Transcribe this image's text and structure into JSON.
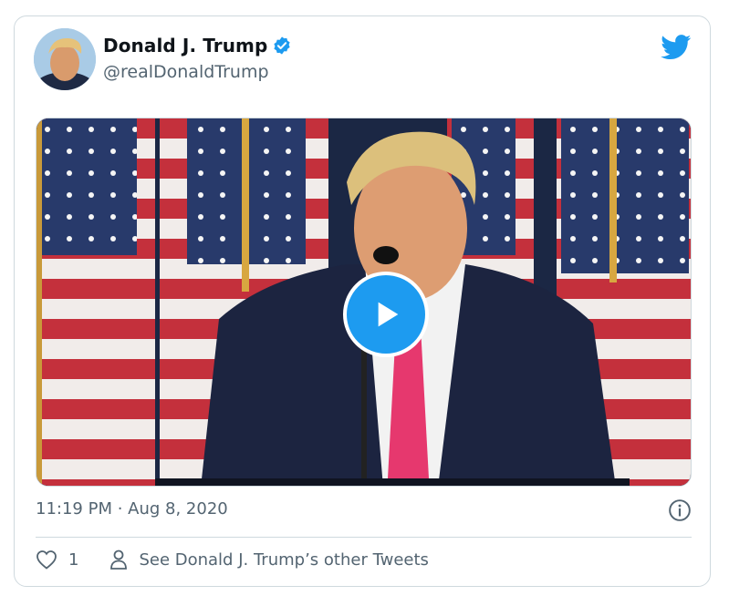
{
  "author": {
    "name": "Donald J. Trump",
    "handle": "@realDonaldTrump",
    "verified": true
  },
  "media": {
    "type": "video",
    "play_icon": "play-icon"
  },
  "timestamp": "11:19 PM · Aug 8, 2020",
  "actions": {
    "like_count": "1",
    "others_label": "See Donald J. Trump’s other Tweets"
  },
  "colors": {
    "accent": "#1d9bf0",
    "text_primary": "#0f1419",
    "text_secondary": "#536471",
    "border": "#cfd9de"
  }
}
